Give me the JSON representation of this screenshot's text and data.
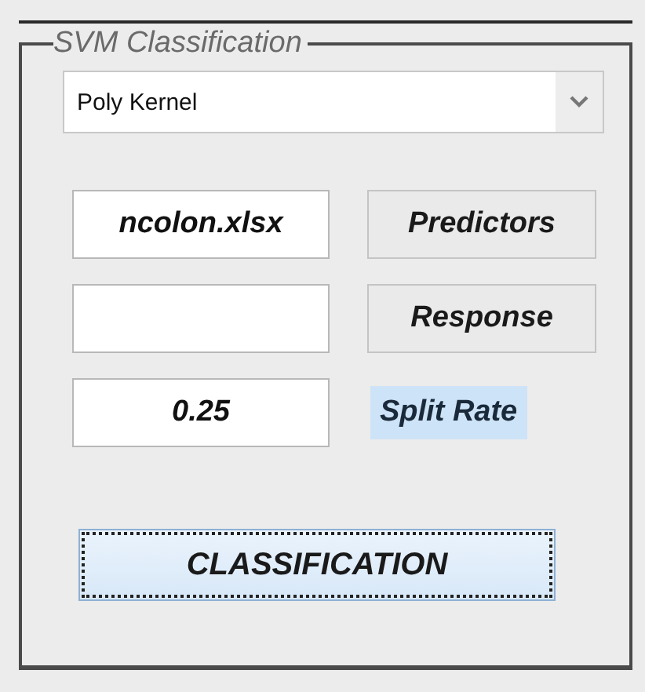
{
  "group": {
    "title": "SVM Classification"
  },
  "kernel_dropdown": {
    "value": "Poly Kernel"
  },
  "predictors": {
    "field_value": "ncolon.xlsx",
    "button": "Predictors"
  },
  "response": {
    "button": "Response"
  },
  "split_rate": {
    "field_value": "0.25",
    "label": "Split Rate"
  },
  "classify_button": {
    "label": "CLASSIFICATION",
    "focused": true
  }
}
